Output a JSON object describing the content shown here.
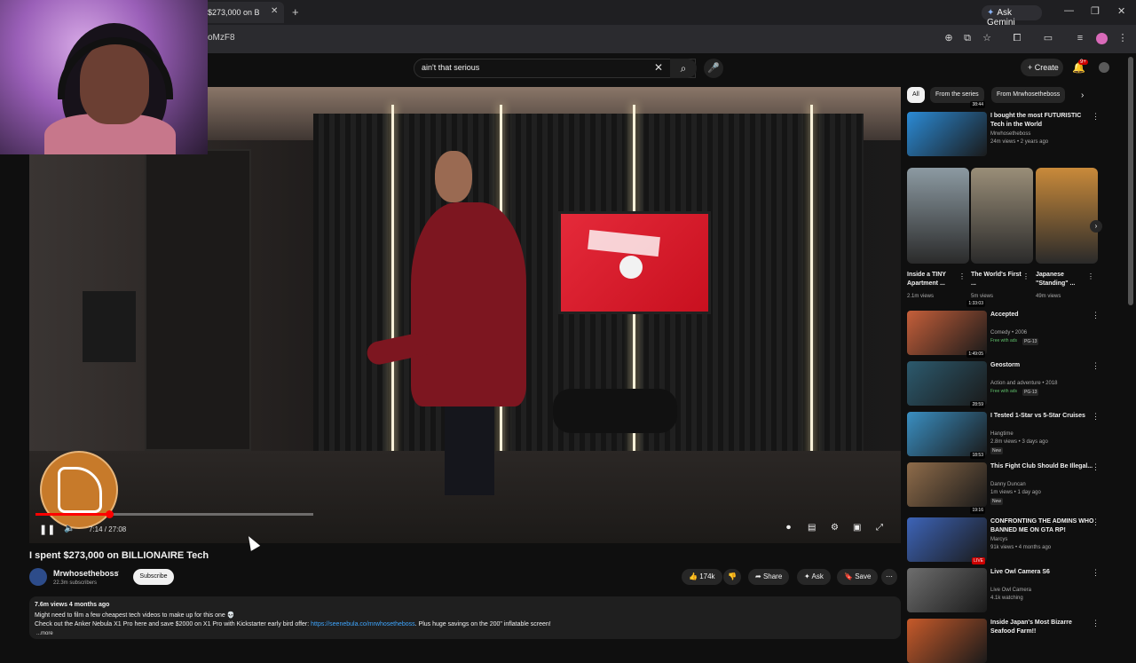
{
  "browser": {
    "tab_title": "$273,000 on B",
    "tab_close": "✕",
    "new_tab": "+",
    "ask_gemini": "Ask Gemini",
    "url": "oMzF8",
    "window_controls": [
      "—",
      "❐",
      "✕"
    ]
  },
  "header": {
    "search_value": "ain't that serious",
    "search_clear": "✕",
    "search_icon": "⌕",
    "mic_icon": "🎤",
    "create_label": "+ Create",
    "notif_count": "9+",
    "bell_icon": "🔔"
  },
  "player": {
    "current_time": "7:14",
    "duration": "27:08",
    "time_display": "7:14 / 27:08",
    "progress": 0.266,
    "pause_icon": "❚❚",
    "volume_icon": "🔈"
  },
  "video": {
    "title": "I spent $273,000 on BILLIONAIRE Tech",
    "channel_name": "Mrwhosetheboss",
    "verified_icon": "✔",
    "subscribers": "22.3m subscribers",
    "subscribe_label": "Subscribe",
    "likes": "174k",
    "share_label": "Share",
    "ask_label": "Ask",
    "save_label": "Save",
    "more_icon": "⋯"
  },
  "description": {
    "meta": "7.6m views  4 months ago",
    "line1": "Might need to film a few cheapest tech videos to make up for this one 💀",
    "line2_prefix": "Check out the Anker Nebula X1 Pro here and save $2000 on X1 Pro with Kickstarter early bird offer: ",
    "line2_link": "https://seenebula.co/mrwhosetheboss",
    "line2_suffix": ". Plus huge savings on the 200\" inflatable screen!",
    "more": "...more"
  },
  "chips": [
    "All",
    "From the series",
    "From Mrwhosetheboss"
  ],
  "chip_next": "›",
  "recommendations": [
    {
      "title": "I bought the most FUTURISTIC Tech in the World",
      "channel": "Mrwhosetheboss",
      "meta": "24m views • 2 years ago",
      "duration": "38:44",
      "color": "#2b8bd6"
    },
    {
      "title": "Accepted",
      "channel": "Comedy • 2006",
      "free": "Free with ads",
      "badge": "PG-13",
      "duration": "1:33:03",
      "color": "#c55f3a"
    },
    {
      "title": "Geostorm",
      "channel": "Action and adventure • 2018",
      "free": "Free with ads",
      "badge": "PG-13",
      "duration": "1:49:05",
      "color": "#2c5a6e"
    },
    {
      "title": "I Tested 1-Star vs 5-Star Cruises",
      "channel": "Hangtime",
      "meta": "2.8m views • 3 days ago",
      "badge": "New",
      "duration": "28:59",
      "color": "#3a8fc2"
    },
    {
      "title": "This Fight Club Should Be Illegal...",
      "channel": "Danny Duncan",
      "meta": "1m views • 1 day ago",
      "badge": "New",
      "duration": "18:53",
      "color": "#8f6c4a"
    },
    {
      "title": "CONFRONTING THE ADMINS WHO BANNED ME ON GTA RP!",
      "channel": "Marcys",
      "meta": "91k views • 4 months ago",
      "duration": "19:16",
      "color": "#3d64b8"
    },
    {
      "title": "Live Owl Camera S6",
      "channel": "Live Owl Camera",
      "meta": "4.1k watching",
      "duration": "LIVE",
      "color": "#6e6e6e"
    },
    {
      "title": "Inside Japan's Most Bizarre Seafood Farm!!",
      "channel": "",
      "meta": "",
      "duration": "",
      "color": "#c75a2a"
    }
  ],
  "shorts": [
    {
      "title": "Inside a TINY Apartment ...",
      "views": "2.1m views",
      "color": "#8c9aa2"
    },
    {
      "title": "The World's First ...",
      "views": "5m views",
      "color": "#9a8e78"
    },
    {
      "title": "Japanese \"Standing\" ...",
      "views": "49m views",
      "color": "#c98a3a"
    }
  ],
  "shorts_next": "›",
  "menu_icon": "⋮"
}
